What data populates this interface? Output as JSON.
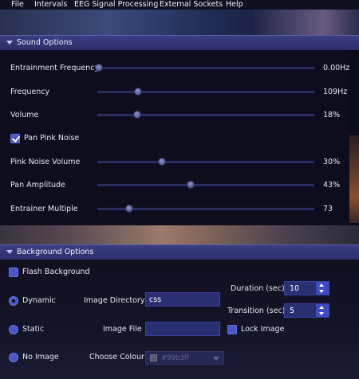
{
  "menu": [
    "File",
    "Intervals",
    "EEG Signal Processing",
    "External Sockets",
    "Help"
  ],
  "sound_options": {
    "title": "Sound Options",
    "sliders": [
      {
        "label": "Entrainment Frequency",
        "value_text": "0.00Hz",
        "level": 0.0
      },
      {
        "label": "Frequency",
        "value_text": "109Hz",
        "level": 0.18
      },
      {
        "label": "Volume",
        "value_text": "18%",
        "level": 0.18
      },
      {
        "label": "Pink Noise Volume",
        "value_text": "30%",
        "level": 0.3
      },
      {
        "label": "Pan Amplitude",
        "value_text": "43%",
        "level": 0.43
      },
      {
        "label": "Entrainer Multiple",
        "value_text": "73",
        "level": 0.14
      }
    ],
    "pan_pink_noise": {
      "label": "Pan Pink Noise",
      "checked": true
    }
  },
  "background_options": {
    "title": "Background Options",
    "flash_background": {
      "label": "Flash Background",
      "checked": false
    },
    "radios": [
      {
        "label": "Dynamic",
        "selected": true
      },
      {
        "label": "Static",
        "selected": false
      },
      {
        "label": "No Image",
        "selected": false
      }
    ],
    "image_directory": {
      "label": "Image Directory",
      "value": "css"
    },
    "image_file": {
      "label": "Image File",
      "value": ""
    },
    "choose_colour": {
      "label": "Choose Colour",
      "value": "#99b3ff"
    },
    "duration": {
      "label": "Duration (sec)",
      "value": "10"
    },
    "transition": {
      "label": "Transition (sec)",
      "value": "5"
    },
    "lock_image": {
      "label": "Lock Image",
      "checked": false
    }
  },
  "colors": {
    "accent": "#4a55c8",
    "header": "#2c2f6a",
    "panel": "#0d0d1e"
  }
}
